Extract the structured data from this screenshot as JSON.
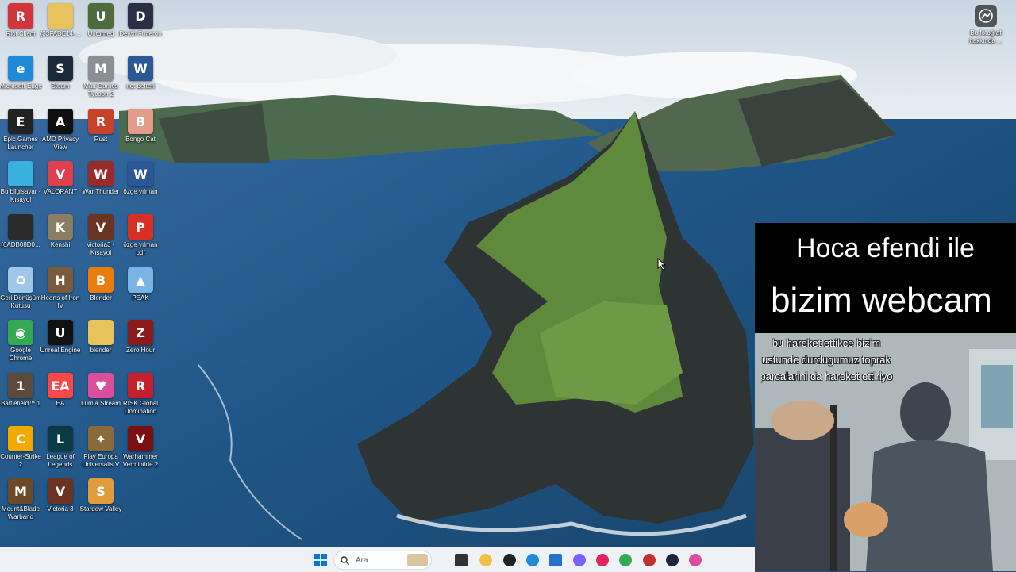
{
  "desktop": {
    "icons": [
      {
        "label": "Riot Client",
        "icon": "riot-icon",
        "color": "#d1363a",
        "glyph": "R"
      },
      {
        "label": "{33FADE14-...",
        "icon": "folder-icon",
        "color": "#e8c25a",
        "glyph": ""
      },
      {
        "label": "Unturned",
        "icon": "unturned-icon",
        "color": "#4d6b3c",
        "glyph": "U"
      },
      {
        "label": "Death Funeron",
        "icon": "game-icon",
        "color": "#2a2f46",
        "glyph": "D"
      },
      {
        "label": "Microsoft Edge",
        "icon": "edge-icon",
        "color": "#1f8ad8",
        "glyph": "e"
      },
      {
        "label": "Steam",
        "icon": "steam-icon",
        "color": "#1b2838",
        "glyph": "S"
      },
      {
        "label": "Mad Games Tycoon 2",
        "icon": "gamepad-icon",
        "color": "#8a8f95",
        "glyph": "M"
      },
      {
        "label": "not defteri",
        "icon": "word-doc-icon",
        "color": "#2b5797",
        "glyph": "W"
      },
      {
        "label": "Epic Games Launcher",
        "icon": "epic-icon",
        "color": "#222222",
        "glyph": "E"
      },
      {
        "label": "AMD Privacy View",
        "icon": "shield-icon",
        "color": "#101010",
        "glyph": "A"
      },
      {
        "label": "Rust",
        "icon": "rust-icon",
        "color": "#c8412b",
        "glyph": "R"
      },
      {
        "label": "Bongo Cat",
        "icon": "bongo-cat-icon",
        "color": "#e49b8a",
        "glyph": "B"
      },
      {
        "label": "Bu bilgisayar - Kısayol",
        "icon": "monitor-icon",
        "color": "#39b0de",
        "glyph": ""
      },
      {
        "label": "VALORANT",
        "icon": "valorant-icon",
        "color": "#e0404d",
        "glyph": "V"
      },
      {
        "label": "War Thunder",
        "icon": "war-thunder-icon",
        "color": "#9a2b2b",
        "glyph": "W"
      },
      {
        "label": "özge yılman",
        "icon": "word-doc-icon",
        "color": "#2b5797",
        "glyph": "W"
      },
      {
        "label": "{6ADB08D0...",
        "icon": "dark-app-icon",
        "color": "#2a2a2a",
        "glyph": ""
      },
      {
        "label": "Kenshi",
        "icon": "kenshi-icon",
        "color": "#8a7d62",
        "glyph": "K"
      },
      {
        "label": "victoria3 - Kısayol",
        "icon": "victoria-icon",
        "color": "#6b3322",
        "glyph": "V"
      },
      {
        "label": "özge yılman pdf",
        "icon": "pdf-icon",
        "color": "#d93025",
        "glyph": "P"
      },
      {
        "label": "Geri Dönüşüm Kutusu",
        "icon": "recycle-bin-icon",
        "color": "#9fc8e8",
        "glyph": "♻"
      },
      {
        "label": "Hearts of Iron IV",
        "icon": "hoi4-icon",
        "color": "#7a5a3c",
        "glyph": "H"
      },
      {
        "label": "Blender",
        "icon": "blender-icon",
        "color": "#e87d0d",
        "glyph": "B"
      },
      {
        "label": "PEAK",
        "icon": "peak-icon",
        "color": "#7ab3e6",
        "glyph": "▲"
      },
      {
        "label": "Google Chrome",
        "icon": "chrome-icon",
        "color": "#34a853",
        "glyph": "◉"
      },
      {
        "label": "Unreal Engine",
        "icon": "unreal-icon",
        "color": "#111111",
        "glyph": "U"
      },
      {
        "label": "blender",
        "icon": "folder-icon",
        "color": "#e8c25a",
        "glyph": ""
      },
      {
        "label": "Zero Hour",
        "icon": "zero-hour-icon",
        "color": "#8b1a1a",
        "glyph": "Z"
      },
      {
        "label": "Battlefield™ 1",
        "icon": "battlefield-icon",
        "color": "#5d4a3a",
        "glyph": "1"
      },
      {
        "label": "EA",
        "icon": "ea-icon",
        "color": "#ff4747",
        "glyph": "EA"
      },
      {
        "label": "Lumia Stream",
        "icon": "lumia-icon",
        "color": "#d94f9c",
        "glyph": "♥"
      },
      {
        "label": "RISK Global Domination",
        "icon": "risk-icon",
        "color": "#c4202b",
        "glyph": "R"
      },
      {
        "label": "Counter-Strike 2",
        "icon": "cs2-icon",
        "color": "#f2a900",
        "glyph": "C"
      },
      {
        "label": "League of Legends",
        "icon": "lol-icon",
        "color": "#0a3b45",
        "glyph": "L"
      },
      {
        "label": "Play Europa Universalis V",
        "icon": "eu5-icon",
        "color": "#8a6a3a",
        "glyph": "✦"
      },
      {
        "label": "Warhammer Vermintide 2",
        "icon": "vermintide-icon",
        "color": "#7a1010",
        "glyph": "V"
      },
      {
        "label": "Mount&Blade Warband",
        "icon": "warband-icon",
        "color": "#6b4a2a",
        "glyph": "M"
      },
      {
        "label": "Victoria 3",
        "icon": "victoria-icon",
        "color": "#6b3322",
        "glyph": "V"
      },
      {
        "label": "Stardew Valley",
        "icon": "stardew-icon",
        "color": "#e09b3d",
        "glyph": "S"
      }
    ],
    "about_photo": {
      "label": "Bu fotoğraf hakkında ..."
    }
  },
  "overlay": {
    "line1": "Hoca efendi ile",
    "line2": "bizim webcam",
    "caption": "bu hareket ettikce bizim ustunde durdugumuz toprak parcalarini da hareket ettiriyo"
  },
  "taskbar": {
    "search_placeholder": "Ara",
    "items": [
      {
        "icon": "windows-start-icon",
        "color": "#0078d4"
      },
      {
        "icon": "task-view-icon",
        "color": "#333333"
      },
      {
        "icon": "file-explorer-icon",
        "color": "#f2c04a"
      },
      {
        "icon": "obs-icon",
        "color": "#222222"
      },
      {
        "icon": "edge-icon",
        "color": "#1f8ad8"
      },
      {
        "icon": "store-icon",
        "color": "#2a6fd0"
      },
      {
        "icon": "copilot-icon",
        "color": "#7b61ff"
      },
      {
        "icon": "opera-icon",
        "color": "#e0245e"
      },
      {
        "icon": "chrome-icon",
        "color": "#34a853"
      },
      {
        "icon": "app-icon",
        "color": "#c23030"
      },
      {
        "icon": "steam-icon",
        "color": "#1b2838"
      },
      {
        "icon": "lumia-icon",
        "color": "#d94f9c"
      }
    ]
  }
}
